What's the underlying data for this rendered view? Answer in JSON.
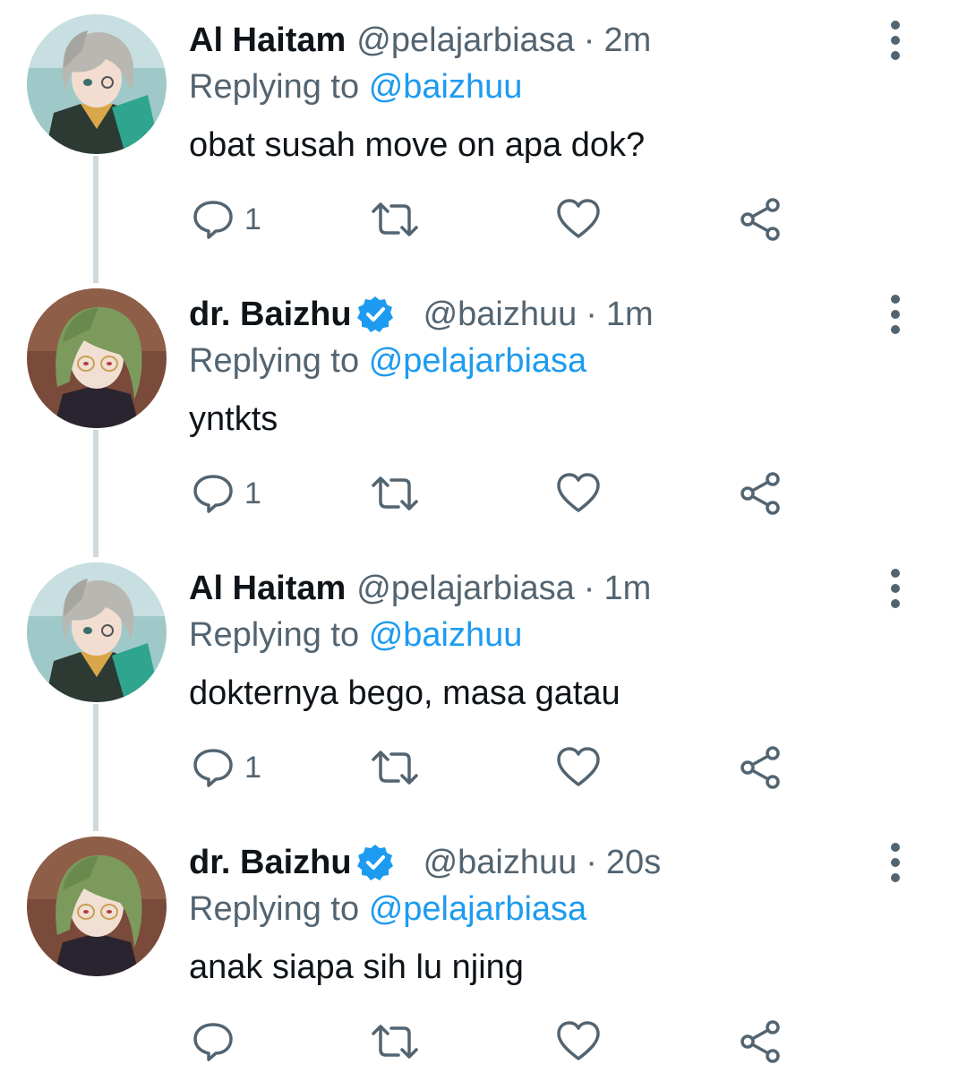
{
  "tweets": [
    {
      "name": "Al Haitam",
      "verified": false,
      "handle": "@pelajarbiasa",
      "separator": "·",
      "time": "2m",
      "replying_prefix": "Replying to",
      "replying_to": "@baizhuu",
      "text": "obat susah move on apa dok?",
      "reply_count": "1",
      "avatar": "alhaitam-avatar"
    },
    {
      "name": "dr. Baizhu",
      "verified": true,
      "handle": "@baizhuu",
      "separator": "·",
      "time": "1m",
      "replying_prefix": "Replying to",
      "replying_to": "@pelajarbiasa",
      "text": "yntkts",
      "reply_count": "1",
      "avatar": "baizhu-avatar"
    },
    {
      "name": "Al Haitam",
      "verified": false,
      "handle": "@pelajarbiasa",
      "separator": "·",
      "time": "1m",
      "replying_prefix": "Replying to",
      "replying_to": "@baizhuu",
      "text": "dokternya bego, masa gatau",
      "reply_count": "1",
      "avatar": "alhaitam-avatar"
    },
    {
      "name": "dr. Baizhu",
      "verified": true,
      "handle": "@baizhuu",
      "separator": "·",
      "time": "20s",
      "replying_prefix": "Replying to",
      "replying_to": "@pelajarbiasa",
      "text": "anak siapa sih lu njing",
      "reply_count": "",
      "avatar": "baizhu-avatar"
    }
  ],
  "icons": {
    "more": "more-vertical-icon",
    "reply": "reply-icon",
    "retweet": "retweet-icon",
    "like": "like-icon",
    "share": "share-icon",
    "verified": "verified-badge-icon"
  },
  "colors": {
    "text_primary": "#0f1419",
    "text_secondary": "#536471",
    "link": "#1d9bf0",
    "verified": "#1d9bf0",
    "thread_line": "#cfd9de"
  }
}
